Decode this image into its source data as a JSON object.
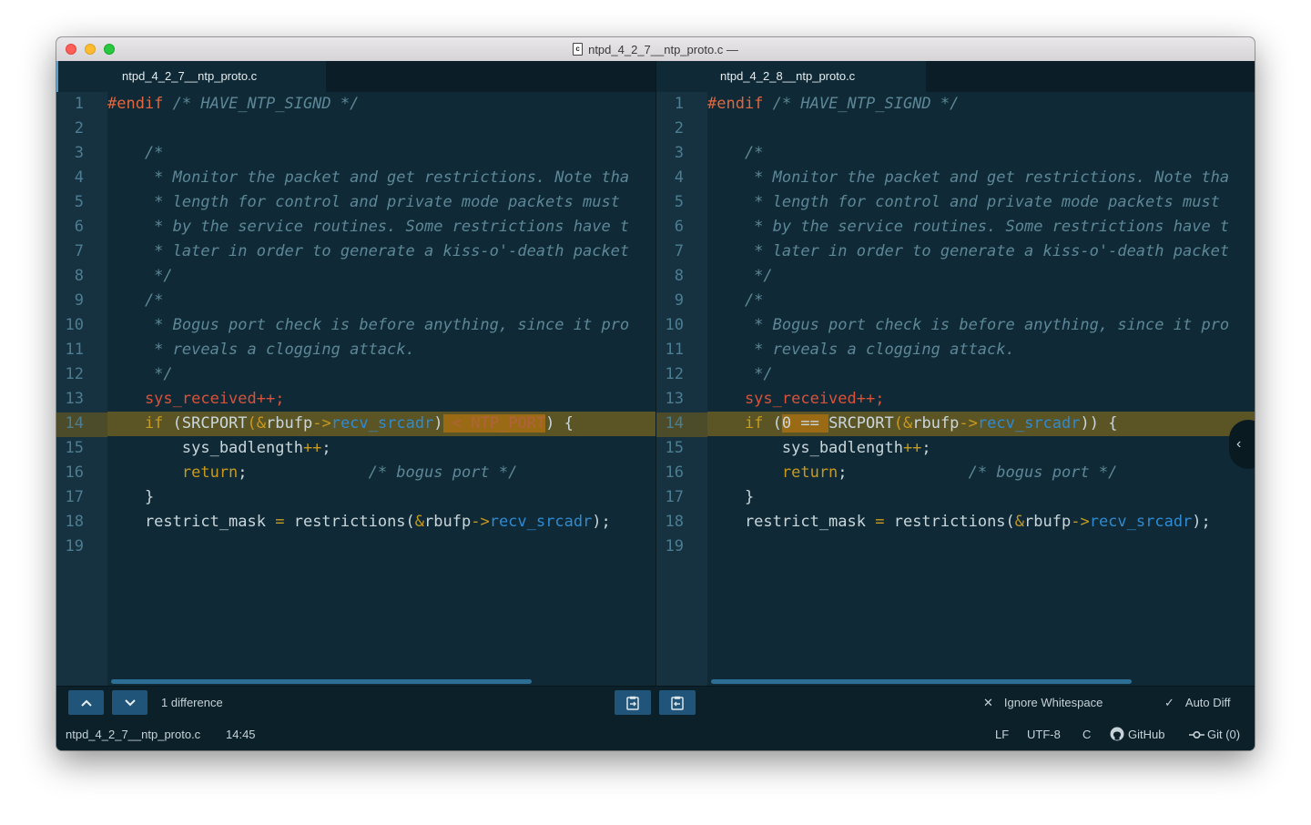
{
  "window": {
    "title": "ntpd_4_2_7__ntp_proto.c —",
    "file_icon_letter": "c"
  },
  "left_pane": {
    "tab_label": "ntpd_4_2_7__ntp_proto.c",
    "line_numbers": [
      "1",
      "2",
      "3",
      "4",
      "5",
      "6",
      "7",
      "8",
      "9",
      "10",
      "11",
      "12",
      "13",
      "14",
      "15",
      "16",
      "17",
      "18",
      "19"
    ]
  },
  "right_pane": {
    "tab_label": "ntpd_4_2_8__ntp_proto.c",
    "line_numbers": [
      "1",
      "2",
      "3",
      "4",
      "5",
      "6",
      "7",
      "8",
      "9",
      "10",
      "11",
      "12",
      "13",
      "14",
      "15",
      "16",
      "17",
      "18",
      "19"
    ]
  },
  "code_left": {
    "l1_a": "#endif",
    "l1_b": " /* HAVE_NTP_SIGND */",
    "l3": "    /*",
    "l4": "     * Monitor the packet and get restrictions. Note tha",
    "l5": "     * length for control and private mode packets must",
    "l6": "     * by the service routines. Some restrictions have t",
    "l7": "     * later in order to generate a kiss-o'-death packet",
    "l8": "     */",
    "l9": "    /*",
    "l10": "     * Bogus port check is before anything, since it pro",
    "l11": "     * reveals a clogging attack.",
    "l12": "     */",
    "l13": "    sys_received++;",
    "l14_kw": "    if",
    "l14_a": " (SRCPORT",
    "l14_b": "(&",
    "l14_c": "rbufp",
    "l14_d": "->",
    "l14_e": "recv_srcadr",
    "l14_f": ")",
    "l14_del": " < NTP_PORT",
    "l14_g": ") {",
    "l15_a": "        sys_badlength",
    "l15_b": "++",
    "l15_c": ";",
    "l16_a": "        return",
    "l16_b": ";",
    "l16_c": "             /* bogus port */",
    "l17": "    }",
    "l18_a": "    restrict_mask ",
    "l18_b": "=",
    "l18_c": " restrictions(",
    "l18_d": "&",
    "l18_e": "rbufp",
    "l18_f": "->",
    "l18_g": "recv_srcadr",
    "l18_h": ");"
  },
  "code_right": {
    "l1_a": "#endif",
    "l1_b": " /* HAVE_NTP_SIGND */",
    "l3": "    /*",
    "l4": "     * Monitor the packet and get restrictions. Note tha",
    "l5": "     * length for control and private mode packets must",
    "l6": "     * by the service routines. Some restrictions have t",
    "l7": "     * later in order to generate a kiss-o'-death packet",
    "l8": "     */",
    "l9": "    /*",
    "l10": "     * Bogus port check is before anything, since it pro",
    "l11": "     * reveals a clogging attack.",
    "l12": "     */",
    "l13": "    sys_received++;",
    "l14_kw": "    if",
    "l14_a": " (",
    "l14_add": "0 == ",
    "l14_b": "SRCPORT",
    "l14_c": "(&",
    "l14_d": "rbufp",
    "l14_e": "->",
    "l14_f": "recv_srcadr",
    "l14_g": ")) {",
    "l15_a": "        sys_badlength",
    "l15_b": "++",
    "l15_c": ";",
    "l16_a": "        return",
    "l16_b": ";",
    "l16_c": "             /* bogus port */",
    "l17": "    }",
    "l18_a": "    restrict_mask ",
    "l18_b": "=",
    "l18_c": " restrictions(",
    "l18_d": "&",
    "l18_e": "rbufp",
    "l18_f": "->",
    "l18_g": "recv_srcadr",
    "l18_h": ");"
  },
  "diff_toolbar": {
    "difference_count": "1 difference",
    "ignore_whitespace_label": "Ignore Whitespace",
    "ignore_whitespace_mark": "✕",
    "auto_diff_label": "Auto Diff",
    "auto_diff_mark": "✓"
  },
  "status_bar": {
    "file_name": "ntpd_4_2_7__ntp_proto.c",
    "cursor_position": "14:45",
    "line_ending": "LF",
    "encoding": "UTF-8",
    "grammar": "C",
    "github_label": "GitHub",
    "git_label": "Git (0)"
  },
  "colors": {
    "editor_bg": "#0f2a36",
    "gutter_bg": "#163240",
    "highlight_row": "#5b5526",
    "keyword": "#c79a1e",
    "preprocessor": "#e0663f",
    "member": "#2f8ad1",
    "button_bg": "#205478"
  }
}
